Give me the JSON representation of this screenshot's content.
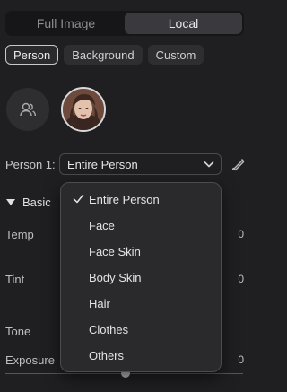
{
  "mode_switch": {
    "tabs": [
      "Full Image",
      "Local"
    ],
    "active": "Local"
  },
  "sub_tabs": {
    "items": [
      "Person",
      "Background",
      "Custom"
    ],
    "active": "Person"
  },
  "avatars": {
    "group_icon": "people-icon",
    "selected_person": "person-thumbnail"
  },
  "person_select": {
    "label": "Person 1:",
    "value": "Entire Person",
    "icon": "chevron-down-icon",
    "brush_icon": "brush-icon"
  },
  "basic": {
    "title": "Basic",
    "rows": [
      {
        "label": "Temp",
        "value": "0"
      },
      {
        "label": "Tint",
        "value": "0"
      },
      {
        "label": "Tone",
        "value": ""
      },
      {
        "label": "Exposure",
        "value": "0"
      }
    ]
  },
  "dropdown": {
    "selected": "Entire Person",
    "items": [
      "Entire Person",
      "Face",
      "Face Skin",
      "Body Skin",
      "Hair",
      "Clothes",
      "Others"
    ]
  },
  "colors": {
    "background": "#1f1f21",
    "temp_track_start": "#3a63e0",
    "temp_track_end": "#e0c23a",
    "tint_track_start": "#4bd04b",
    "tint_track_end": "#d04bd0"
  }
}
